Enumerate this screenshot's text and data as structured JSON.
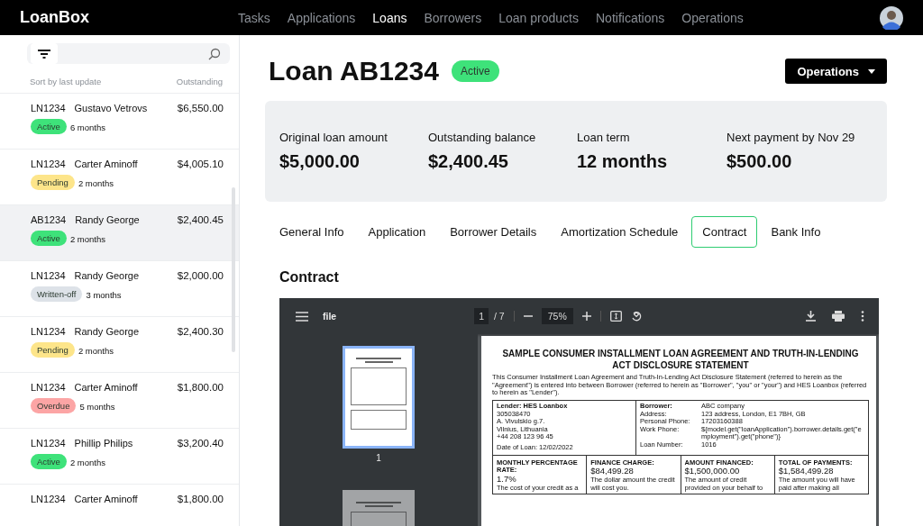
{
  "topbar": {
    "logo": "LoanBox",
    "nav": [
      {
        "label": "Tasks",
        "selected": false
      },
      {
        "label": "Applications",
        "selected": false
      },
      {
        "label": "Loans",
        "selected": true
      },
      {
        "label": "Borrowers",
        "selected": false
      },
      {
        "label": "Loan products",
        "selected": false
      },
      {
        "label": "Notifications",
        "selected": false
      },
      {
        "label": "Operations",
        "selected": false
      }
    ]
  },
  "sidebar": {
    "sort_label": "Sort by last update",
    "column_label": "Outstanding",
    "items": [
      {
        "code": "LN1234",
        "name": "Gustavo Vetrovs",
        "amount": "$6,550.00",
        "status": "Active",
        "color": "#3ee27a",
        "term": "6 months",
        "selected": false
      },
      {
        "code": "LN1234",
        "name": "Carter Aminoff",
        "amount": "$4,005.10",
        "status": "Pending",
        "color": "#fde58a",
        "term": "2 months",
        "selected": false
      },
      {
        "code": "AB1234",
        "name": "Randy George",
        "amount": "$2,400.45",
        "status": "Active",
        "color": "#3ee27a",
        "term": "2 months",
        "selected": true
      },
      {
        "code": "LN1234",
        "name": "Randy George",
        "amount": "$2,000.00",
        "status": "Written-off",
        "color": "#dde2e8",
        "term": "3 months",
        "selected": false
      },
      {
        "code": "LN1234",
        "name": "Randy George",
        "amount": "$2,400.30",
        "status": "Pending",
        "color": "#fde58a",
        "term": "2 months",
        "selected": false
      },
      {
        "code": "LN1234",
        "name": "Carter Aminoff",
        "amount": "$1,800.00",
        "status": "Overdue",
        "color": "#fca5a5",
        "term": "5 months",
        "selected": false
      },
      {
        "code": "LN1234",
        "name": "Phillip Philips",
        "amount": "$3,200.40",
        "status": "Active",
        "color": "#3ee27a",
        "term": "2 months",
        "selected": false
      },
      {
        "code": "LN1234",
        "name": "Carter Aminoff",
        "amount": "$1,800.00"
      }
    ]
  },
  "loan": {
    "title": "Loan AB1234",
    "status": "Active",
    "operations_button": "Operations",
    "stats": [
      {
        "label": "Original loan amount",
        "value": "$5,000.00"
      },
      {
        "label": "Outstanding balance",
        "value": "$2,400.45"
      },
      {
        "label": "Loan term",
        "value": "12 months"
      },
      {
        "label": "Next payment by Nov 29",
        "value": "$500.00"
      }
    ],
    "tabs": [
      {
        "label": "General Info",
        "selected": false
      },
      {
        "label": "Application",
        "selected": false
      },
      {
        "label": "Borrower Details",
        "selected": false
      },
      {
        "label": "Amortization Schedule",
        "selected": false
      },
      {
        "label": "Contract",
        "selected": true
      },
      {
        "label": "Bank Info",
        "selected": false
      }
    ],
    "section_title": "Contract"
  },
  "pdf_viewer": {
    "file_name": "file",
    "page": "1",
    "page_count": "/ 7",
    "zoom": "75%",
    "thumbnails": [
      {
        "label": "1",
        "selected": true
      },
      {
        "selected": false
      }
    ],
    "document": {
      "title": "SAMPLE CONSUMER INSTALLMENT LOAN AGREEMENT AND TRUTH-IN-LENDING ACT DISCLOSURE STATEMENT",
      "intro": "This Consumer Installment Loan Agreement and Truth-In-Lending Act Disclosure Statement (referred to herein as the \"Agreement\") is entered into between Borrower (referred to herein as \"Borrower\", \"you\" or \"your\") and HES Loanbox (referred to herein as \"Lender\").",
      "lender": {
        "heading": "Lender: HES Loanbox",
        "lines": [
          "305038470",
          "A. Vivulskio g.7.",
          "Vilnius, Lithuania",
          "+44 208 123 96 45"
        ],
        "date": "Date of Loan: 12/02/2022"
      },
      "borrower": [
        {
          "label": "Borrower:",
          "value": "ABC company"
        },
        {
          "label": "Address:",
          "value": "123 address, London, E1 7BH, GB"
        },
        {
          "label": "Personal Phone:",
          "value": "17203160388"
        },
        {
          "label": "Work Phone:",
          "value": "${model.get(\"loanApplication\").borrower.details.get(\"employment\").get(\"phone\")}"
        },
        {
          "label": "Loan Number:",
          "value": "1016"
        }
      ],
      "terms": [
        {
          "heading": "MONTHLY PERCENTAGE RATE:",
          "value": "1.7%",
          "text": "The cost of your credit as a"
        },
        {
          "heading": "FINANCE CHARGE:",
          "value": "$84,499.28",
          "text": "The dollar amount the credit will cost you."
        },
        {
          "heading": "AMOUNT FINANCED:",
          "value": "$1,500,000.00",
          "text": "The amount of credit provided on your behalf to"
        },
        {
          "heading": "TOTAL OF PAYMENTS:",
          "value": "$1,584,499.28",
          "text": "The amount you will have paid after making all"
        }
      ]
    }
  }
}
